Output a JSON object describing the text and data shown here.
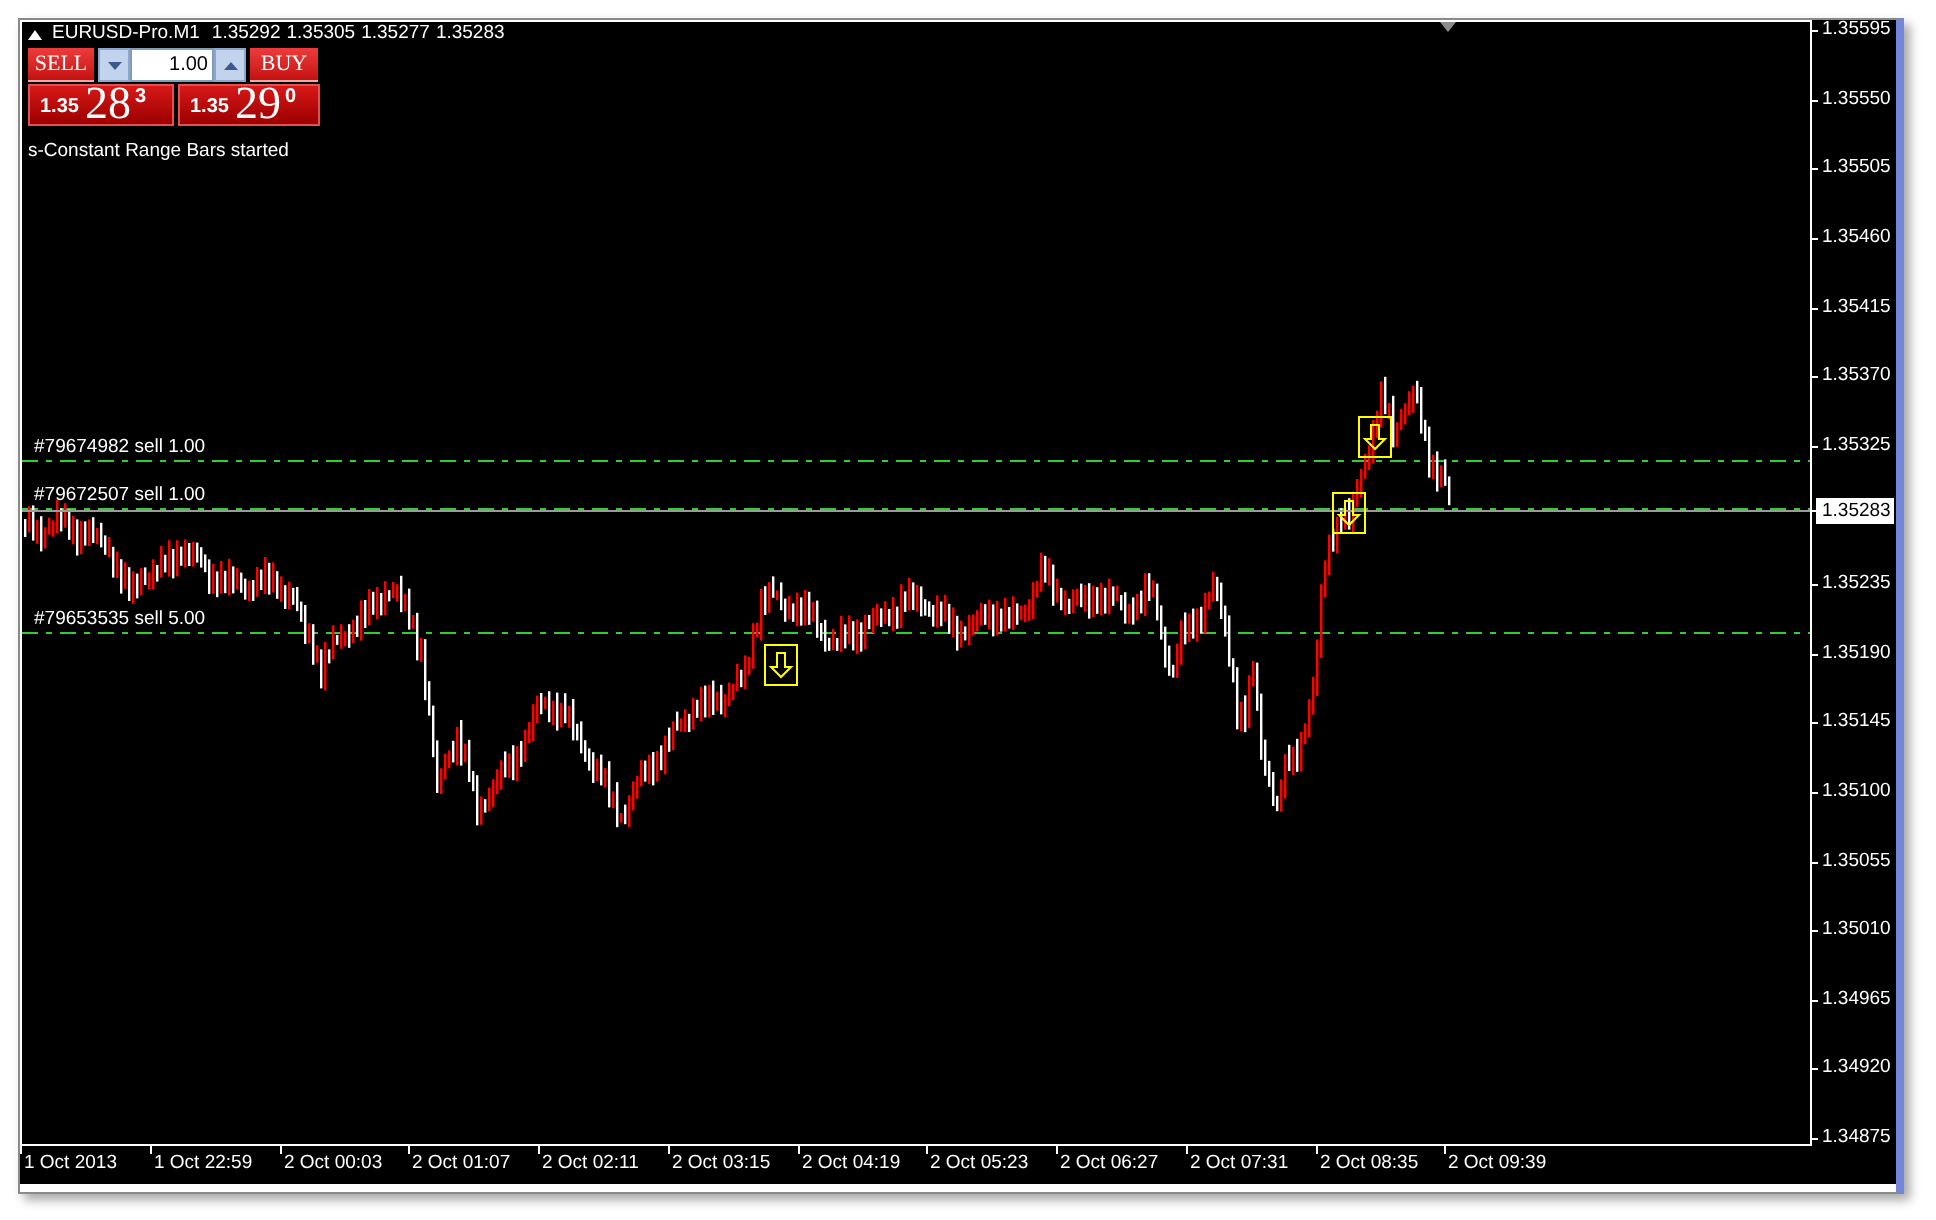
{
  "header": {
    "symbol": "EURUSD-Pro.M1",
    "ohlc": [
      "1.35292",
      "1.35305",
      "1.35277",
      "1.35283"
    ]
  },
  "trade_panel": {
    "sell_button": "SELL",
    "lot_size": "1.00",
    "buy_button": "BUY",
    "sell_price": {
      "prefix": "1.35",
      "pips": "28",
      "fraction": "3"
    },
    "buy_price": {
      "prefix": "1.35",
      "pips": "29",
      "fraction": "0"
    }
  },
  "message": "s-Constant Range Bars started",
  "order_lines": [
    {
      "label": "#79674982 sell 1.00"
    },
    {
      "label": "#79672507 sell 1.00"
    },
    {
      "label": "#79653535 sell 5.00"
    }
  ],
  "price_axis": {
    "ticks": [
      "1.35595",
      "1.35550",
      "1.35505",
      "1.35460",
      "1.35415",
      "1.35370",
      "1.35325",
      "1.35235",
      "1.35190",
      "1.35145",
      "1.35100",
      "1.35055",
      "1.35010",
      "1.34965",
      "1.34920",
      "1.34875"
    ],
    "current_price": "1.35283"
  },
  "time_axis": {
    "ticks": [
      "1 Oct 2013",
      "1 Oct 22:59",
      "2 Oct 00:03",
      "2 Oct 01:07",
      "2 Oct 02:11",
      "2 Oct 03:15",
      "2 Oct 04:19",
      "2 Oct 05:23",
      "2 Oct 06:27",
      "2 Oct 07:31",
      "2 Oct 08:35",
      "2 Oct 09:39"
    ]
  }
}
